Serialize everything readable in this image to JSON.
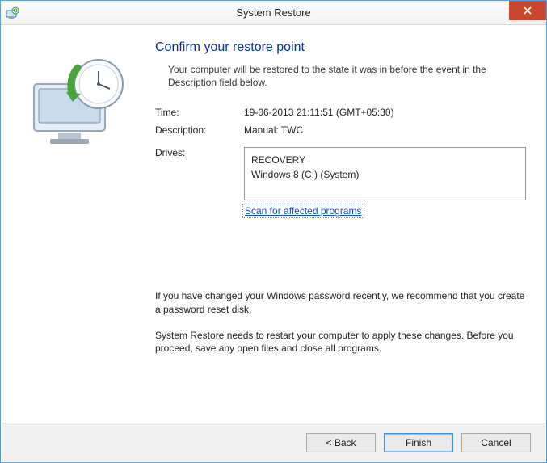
{
  "window": {
    "title": "System Restore"
  },
  "heading": "Confirm your restore point",
  "intro": "Your computer will be restored to the state it was in before the event in the Description field below.",
  "fields": {
    "time_label": "Time:",
    "time_value": "19-06-2013 21:11:51 (GMT+05:30)",
    "desc_label": "Description:",
    "desc_value": "Manual: TWC",
    "drives_label": "Drives:"
  },
  "drives": [
    "RECOVERY",
    "Windows 8 (C:) (System)"
  ],
  "scan_link": "Scan for affected programs",
  "warning_password": "If you have changed your Windows password recently, we recommend that you create a password reset disk.",
  "warning_restart": "System Restore needs to restart your computer to apply these changes. Before you proceed, save any open files and close all programs.",
  "buttons": {
    "back": "< Back",
    "finish": "Finish",
    "cancel": "Cancel"
  }
}
